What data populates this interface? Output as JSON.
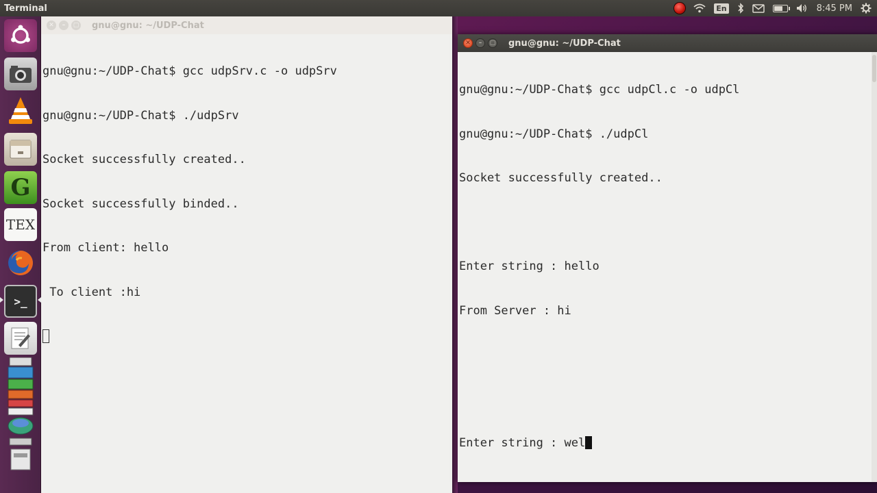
{
  "panel": {
    "app_title": "Terminal",
    "language": "En",
    "clock": "8:45 PM",
    "battery_level": 0.7,
    "indicators": [
      "record-icon",
      "wifi-icon",
      "keyboard-language-icon",
      "bluetooth-icon",
      "mail-icon",
      "battery-icon",
      "volume-icon",
      "clock",
      "gear-icon"
    ]
  },
  "launcher": {
    "items": [
      {
        "name": "ubuntu-dash-icon"
      },
      {
        "name": "camera-app-icon"
      },
      {
        "name": "vlc-icon"
      },
      {
        "name": "file-manager-icon"
      },
      {
        "name": "geany-icon",
        "glyph": "G"
      },
      {
        "name": "texmaker-icon",
        "glyph": "TEX"
      },
      {
        "name": "firefox-icon"
      },
      {
        "name": "terminal-icon",
        "glyph": ">_",
        "active": true
      },
      {
        "name": "text-editor-icon"
      },
      {
        "name": "stacked-apps-icon"
      }
    ]
  },
  "server_window": {
    "title": "gnu@gnu: ~/UDP-Chat",
    "lines": [
      "gnu@gnu:~/UDP-Chat$ gcc udpSrv.c -o udpSrv",
      "gnu@gnu:~/UDP-Chat$ ./udpSrv",
      "Socket successfully created..",
      "Socket successfully binded..",
      "From client: hello",
      " To client :hi"
    ]
  },
  "client_window": {
    "title": "gnu@gnu: ~/UDP-Chat",
    "lines": [
      "gnu@gnu:~/UDP-Chat$ gcc udpCl.c -o udpCl",
      "gnu@gnu:~/UDP-Chat$ ./udpCl",
      "Socket successfully created..",
      "",
      "Enter string : hello",
      "From Server : hi",
      "",
      ""
    ],
    "input_line": "Enter string : wel"
  }
}
